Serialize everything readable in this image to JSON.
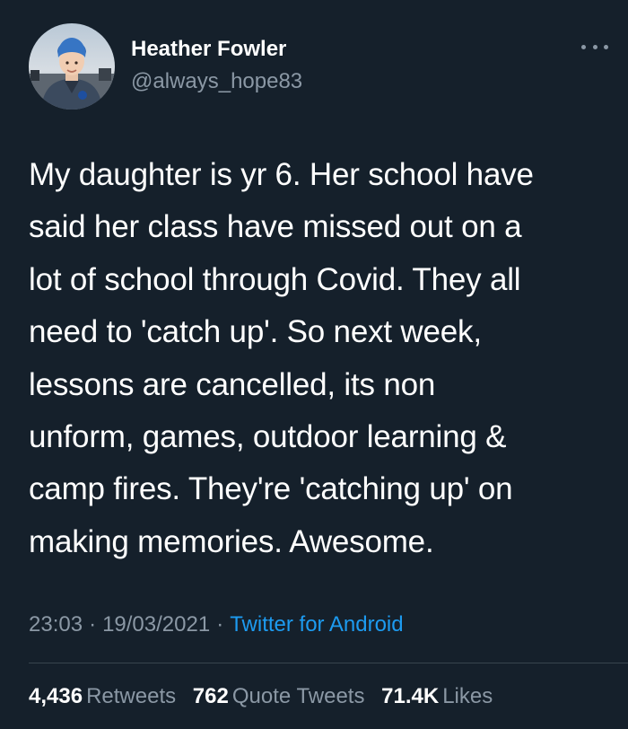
{
  "user": {
    "display_name": "Heather Fowler",
    "handle": "@always_hope83"
  },
  "tweet": {
    "lines": [
      "My daughter is yr 6. Her school have",
      "said her class have missed out on a",
      "lot of school through Covid. They all",
      "need to 'catch up'. So next week,",
      "lessons are cancelled, its non",
      "unform, games, outdoor learning &",
      "camp fires. They're 'catching up' on",
      "making memories. Awesome."
    ],
    "time": "23:03",
    "date": "19/03/2021",
    "separator": "·",
    "source": "Twitter for Android"
  },
  "stats": {
    "retweets": {
      "count": "4,436",
      "label": "Retweets"
    },
    "quotes": {
      "count": "762",
      "label": "Quote Tweets"
    },
    "likes": {
      "count": "71.4K",
      "label": "Likes"
    }
  },
  "icons": {
    "more": "more-horizontal-icon",
    "avatar": "avatar"
  },
  "colors": {
    "background": "#15202b",
    "text_primary": "#ffffff",
    "text_secondary": "#8b98a5",
    "link": "#1d9bf0",
    "divider": "#38444d"
  }
}
